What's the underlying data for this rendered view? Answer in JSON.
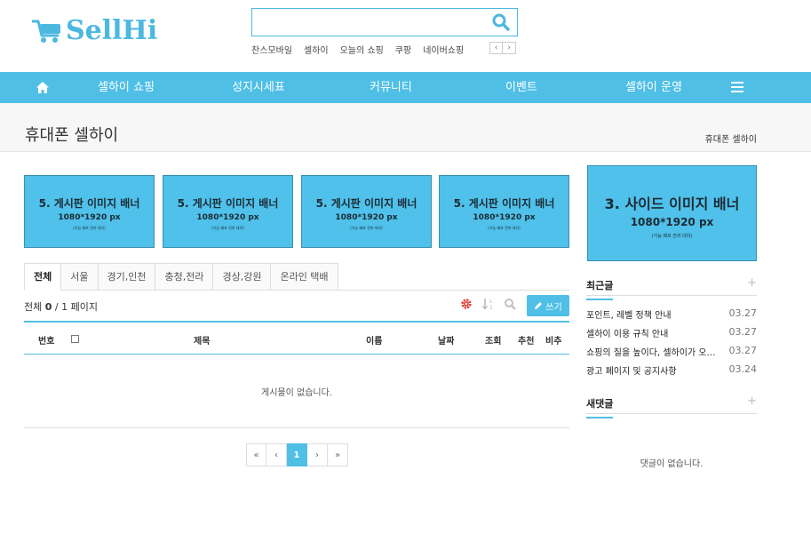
{
  "brand": {
    "name": "SellHi",
    "color": "#4cb8df"
  },
  "search": {
    "value": "",
    "placeholder": ""
  },
  "quick_links": [
    "찬스모바일",
    "셀하이",
    "오늘의 쇼핑",
    "쿠팡",
    "네이버쇼핑"
  ],
  "quick_arrows": {
    "prev": "‹",
    "next": "›"
  },
  "nav": {
    "items": [
      "셀하이 쇼핑",
      "성지시세표",
      "커뮤니티",
      "이벤트",
      "셀하이 운영"
    ],
    "bg_color": "#4fbfe6"
  },
  "page": {
    "title": "휴대폰 셀하이",
    "breadcrumb": "휴대폰 셀하이"
  },
  "banners": [
    {
      "title": "5. 게시판 이미지 배너",
      "size": "1080*1920 px",
      "note": "(기능 배포 전까 대치)"
    },
    {
      "title": "5. 게시판 이미지 배너",
      "size": "1080*1920 px",
      "note": "(기능 배포 전까 대치)"
    },
    {
      "title": "5. 게시판 이미지 배너",
      "size": "1080*1920 px",
      "note": "(기능 배포 전까 대치)"
    },
    {
      "title": "5. 게시판 이미지 배너",
      "size": "1080*1920 px",
      "note": "(기능 배포 전까 대치)"
    }
  ],
  "side_banner": {
    "title": "3. 사이드 이미지 배너",
    "size": "1080*1920 px",
    "note": "(기능 배포 전까 대치)"
  },
  "board": {
    "tabs": [
      "전체",
      "서울",
      "경기,인천",
      "충청,전라",
      "경상,강원",
      "온라인 택배"
    ],
    "active_tab": "전체",
    "count_prefix": "전체",
    "count_total": "0",
    "count_suffix": "/ 1 페이지",
    "write_label": "쓰기",
    "columns": [
      "번호",
      "제목",
      "이름",
      "날짜",
      "조회",
      "추천",
      "비추"
    ],
    "empty_message": "게시물이 없습니다.",
    "rows": []
  },
  "pagination": {
    "first": "«",
    "prev": "‹",
    "current": "1",
    "next": "›",
    "last": "»"
  },
  "sidebar": {
    "recent": {
      "title": "최근글",
      "more": "+",
      "posts": [
        {
          "title": "포인트, 레벨 정책 안내",
          "date": "03.27"
        },
        {
          "title": "셀하이 이용 규칙 안내",
          "date": "03.27"
        },
        {
          "title": "쇼핑의 질을 높이다, 셀하이가 오…",
          "date": "03.27"
        },
        {
          "title": "광고 페이지 및 공지사항",
          "date": "03.24"
        }
      ]
    },
    "comments": {
      "title": "새댓글",
      "more": "+",
      "empty_message": "댓글이 없습니다."
    }
  }
}
